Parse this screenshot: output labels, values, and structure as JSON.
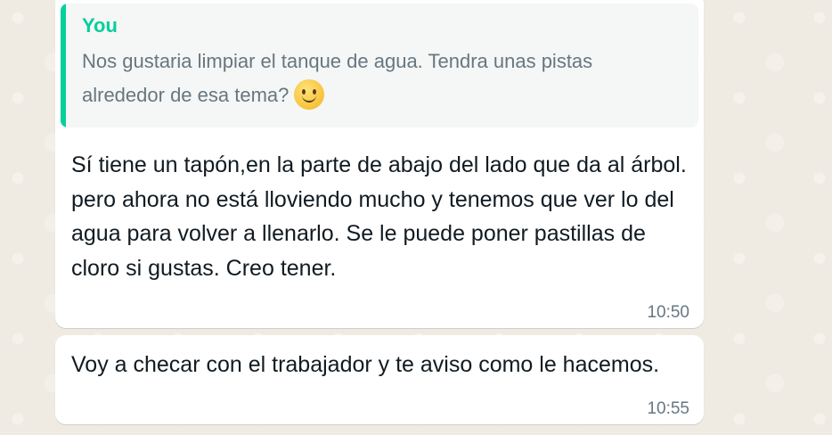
{
  "messages": [
    {
      "quote": {
        "author": "You",
        "text": "Nos gustaria limpiar el tanque de agua. Tendra unas pistas alrededor de esa tema?",
        "emoji": "slightly-smiling-face-icon"
      },
      "text": "Sí tiene un tapón,en la parte de abajo del lado que da al árbol. pero ahora no está lloviendo mucho y tenemos que ver lo del agua para volver a llenarlo. Se le puede poner pastillas de cloro si gustas. Creo tener.",
      "time": "10:50"
    },
    {
      "text": "Voy a checar con el trabajador y te aviso como le hacemos.",
      "time": "10:55"
    }
  ],
  "colors": {
    "background": "#efeae2",
    "bubble": "#ffffff",
    "quote_accent": "#06cf9c",
    "quote_bg": "#f5f6f6",
    "text": "#111b21",
    "meta": "#667781"
  }
}
